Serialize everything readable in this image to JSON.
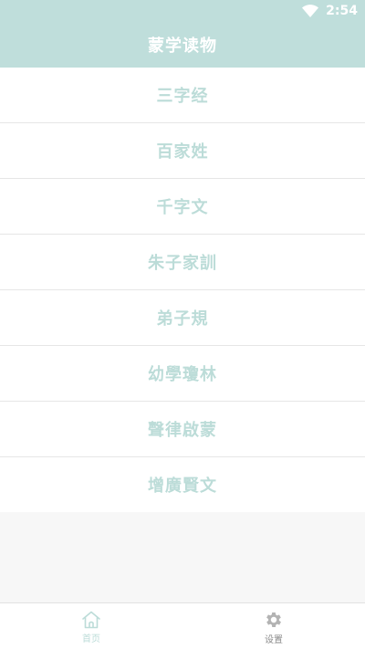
{
  "status_bar": {
    "time": "2:54",
    "icons": [
      "wifi-icon"
    ]
  },
  "header": {
    "title": "蒙学读物"
  },
  "book_list": [
    {
      "label": "三字经"
    },
    {
      "label": "百家姓"
    },
    {
      "label": "千字文"
    },
    {
      "label": "朱子家訓"
    },
    {
      "label": "弟子規"
    },
    {
      "label": "幼學瓊林"
    },
    {
      "label": "聲律啟蒙"
    },
    {
      "label": "增廣賢文"
    }
  ],
  "bottom_nav": {
    "items": [
      {
        "label": "首页",
        "icon": "home-icon",
        "active": true
      },
      {
        "label": "设置",
        "icon": "gear-icon",
        "active": false
      }
    ]
  },
  "colors": {
    "header_bg": "#bfdedb",
    "list_text": "#bcdcd8",
    "active_tab": "#bcdcd8",
    "inactive_tab": "#8a8a8a"
  }
}
